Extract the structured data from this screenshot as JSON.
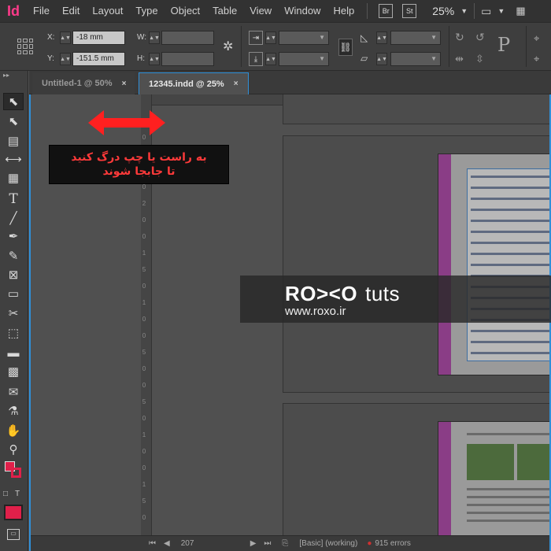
{
  "app": {
    "logo": "Id"
  },
  "menu": [
    "File",
    "Edit",
    "Layout",
    "Type",
    "Object",
    "Table",
    "View",
    "Window",
    "Help"
  ],
  "app_buttons": {
    "bridge": "Br",
    "stock": "St"
  },
  "zoom": "25%",
  "control": {
    "x_label": "X:",
    "x_value": "-18 mm",
    "y_label": "Y:",
    "y_value": "-151.5 mm",
    "w_label": "W:",
    "h_label": "H:",
    "p_label": "P"
  },
  "tabs": [
    {
      "label": "Untitled-1 @ 50%",
      "close": "×"
    },
    {
      "label": "12345.indd @ 25%",
      "close": "×"
    }
  ],
  "ruler_marks": [
    "5",
    "0",
    "2",
    "5",
    "0",
    "2",
    "0",
    "0",
    "1",
    "5",
    "0",
    "1",
    "0",
    "0",
    "5",
    "0",
    "0",
    "5",
    "0",
    "1",
    "0",
    "0",
    "1",
    "5",
    "0"
  ],
  "status": {
    "page": "207",
    "style": "[Basic] (working)",
    "errors": "915 errors"
  },
  "hint": {
    "line1": "به راست یا چپ درگ کنید",
    "line2": "تا جابجا شوند"
  },
  "watermark": {
    "brand": "RO><O",
    "suffix": "tuts",
    "url": "www.roxo.ir"
  },
  "colors": {
    "accent": "#2f8fd8",
    "hint_text": "#ff3a3a",
    "arrow": "#ff2020",
    "logo": "#ff3a8a"
  }
}
